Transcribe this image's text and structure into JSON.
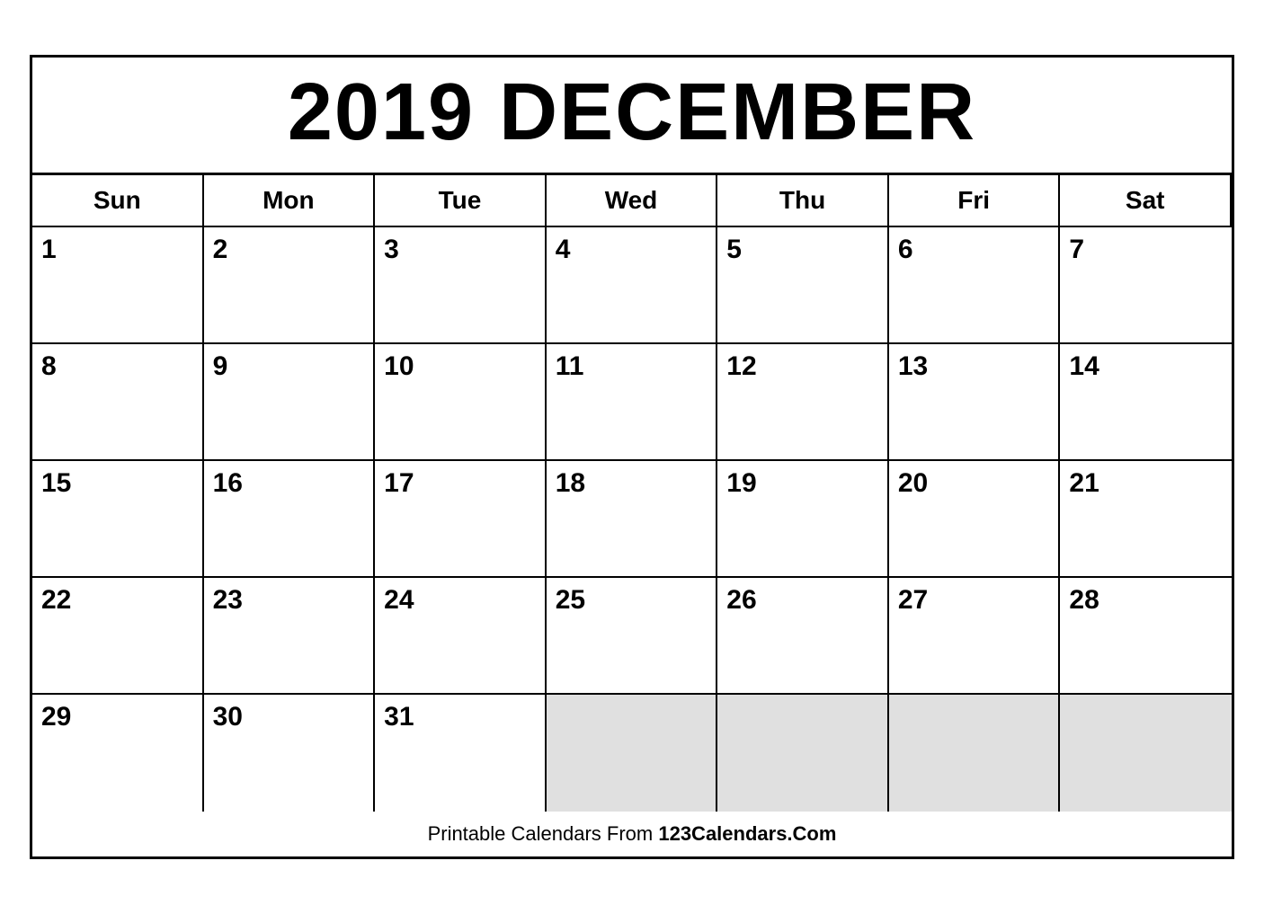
{
  "calendar": {
    "title": "2019 DECEMBER",
    "year": "2019",
    "month": "DECEMBER",
    "days_of_week": [
      "Sun",
      "Mon",
      "Tue",
      "Wed",
      "Thu",
      "Fri",
      "Sat"
    ],
    "weeks": [
      [
        {
          "day": "1",
          "empty": false
        },
        {
          "day": "2",
          "empty": false
        },
        {
          "day": "3",
          "empty": false
        },
        {
          "day": "4",
          "empty": false
        },
        {
          "day": "5",
          "empty": false
        },
        {
          "day": "6",
          "empty": false
        },
        {
          "day": "7",
          "empty": false
        }
      ],
      [
        {
          "day": "8",
          "empty": false
        },
        {
          "day": "9",
          "empty": false
        },
        {
          "day": "10",
          "empty": false
        },
        {
          "day": "11",
          "empty": false
        },
        {
          "day": "12",
          "empty": false
        },
        {
          "day": "13",
          "empty": false
        },
        {
          "day": "14",
          "empty": false
        }
      ],
      [
        {
          "day": "15",
          "empty": false
        },
        {
          "day": "16",
          "empty": false
        },
        {
          "day": "17",
          "empty": false
        },
        {
          "day": "18",
          "empty": false
        },
        {
          "day": "19",
          "empty": false
        },
        {
          "day": "20",
          "empty": false
        },
        {
          "day": "21",
          "empty": false
        }
      ],
      [
        {
          "day": "22",
          "empty": false
        },
        {
          "day": "23",
          "empty": false
        },
        {
          "day": "24",
          "empty": false
        },
        {
          "day": "25",
          "empty": false
        },
        {
          "day": "26",
          "empty": false
        },
        {
          "day": "27",
          "empty": false
        },
        {
          "day": "28",
          "empty": false
        }
      ],
      [
        {
          "day": "29",
          "empty": false
        },
        {
          "day": "30",
          "empty": false
        },
        {
          "day": "31",
          "empty": false
        },
        {
          "day": "",
          "empty": true
        },
        {
          "day": "",
          "empty": true
        },
        {
          "day": "",
          "empty": true
        },
        {
          "day": "",
          "empty": true
        }
      ]
    ],
    "footer": {
      "prefix": "Printable Calendars From ",
      "brand": "123Calendars.Com"
    }
  }
}
